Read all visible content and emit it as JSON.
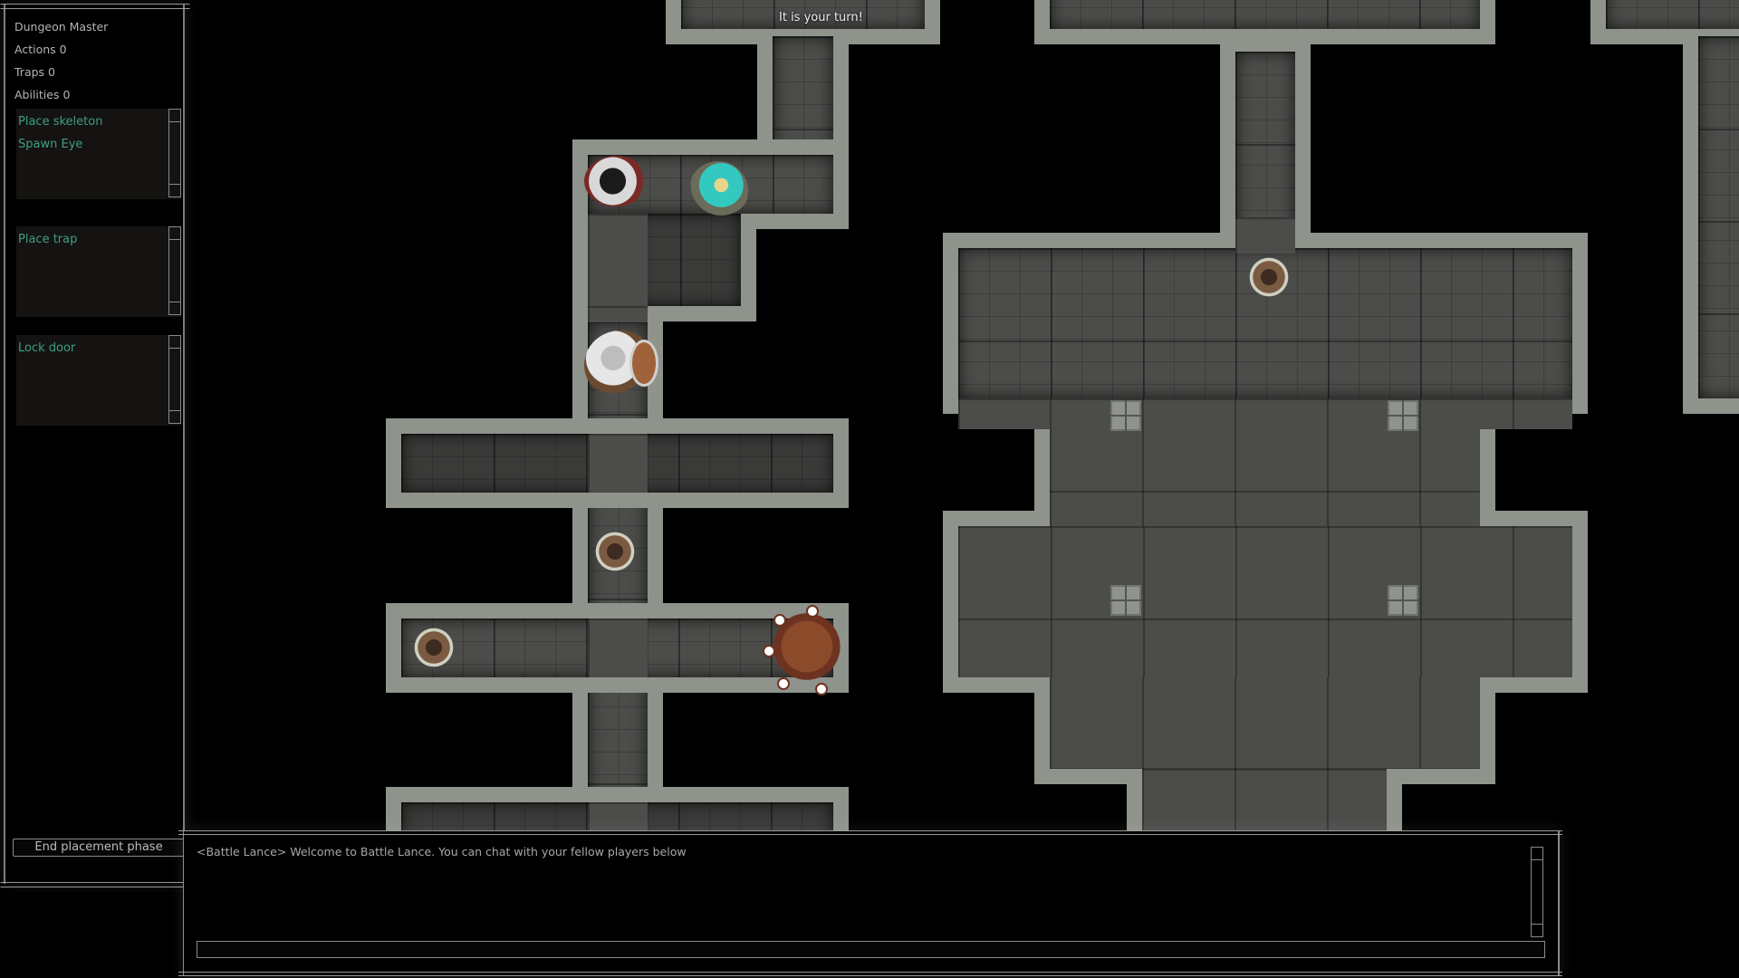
{
  "banner": {
    "turn_text": "It is your turn!"
  },
  "side_panel": {
    "role": "Dungeon Master",
    "stats": [
      {
        "label": "Actions",
        "value": "0",
        "text": "Actions 0"
      },
      {
        "label": "Traps",
        "value": "0",
        "text": "Traps 0"
      },
      {
        "label": "Abilities",
        "value": "0",
        "text": "Abilities 0"
      }
    ],
    "lists": [
      {
        "name": "actions",
        "items": [
          "Place skeleton",
          "Spawn Eye"
        ]
      },
      {
        "name": "traps",
        "items": [
          "Place trap"
        ]
      },
      {
        "name": "abilities",
        "items": [
          "Lock door"
        ]
      }
    ],
    "end_button_label": "End placement phase"
  },
  "chat": {
    "messages": [
      {
        "sender": "<Battle Lance>",
        "text": "Welcome to Battle Lance. You can chat with your fellow players below",
        "line": "<Battle Lance> Welcome to Battle Lance. You can chat with your fellow players below"
      }
    ],
    "input_value": "",
    "input_placeholder": ""
  },
  "map": {
    "tokens": [
      {
        "id": "rogue",
        "label": "rogue hero",
        "icon": "rogue-token"
      },
      {
        "id": "cleric",
        "label": "cleric hero with teal cloak",
        "icon": "cleric-token"
      },
      {
        "id": "dwarf",
        "label": "dwarf warrior with shield",
        "icon": "dwarf-token"
      },
      {
        "id": "skeleton-1",
        "label": "skeleton",
        "icon": "skeleton-token"
      },
      {
        "id": "skeleton-2",
        "label": "skeleton",
        "icon": "skeleton-token"
      },
      {
        "id": "skeleton-3",
        "label": "skeleton",
        "icon": "skeleton-token"
      },
      {
        "id": "eye",
        "label": "floating eye monster",
        "icon": "eye-monster-token"
      }
    ]
  },
  "colors": {
    "background": "#000000",
    "list_text": "#3f9e84",
    "panel_border": "#8a8a8a",
    "wall_stone": "#8e938c",
    "floor_stone": "#4c4c4a",
    "cleric_cloak": "#33c9c0"
  }
}
